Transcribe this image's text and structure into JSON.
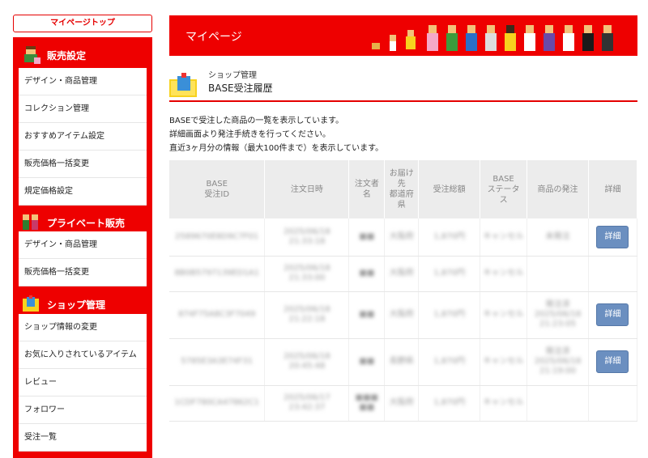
{
  "sidebar": {
    "top_button": "マイページトップ",
    "sections": [
      {
        "label": "販売設定",
        "icon": "seller-avatar-icon",
        "items": [
          "デザイン・商品管理",
          "コレクション管理",
          "おすすめアイテム設定",
          "販売価格一括変更",
          "規定価格設定"
        ]
      },
      {
        "label": "プライベート販売",
        "icon": "private-sale-icon",
        "items": [
          "デザイン・商品管理",
          "販売価格一括変更"
        ]
      },
      {
        "label": "ショップ管理",
        "icon": "shop-icon",
        "items": [
          "ショップ情報の変更",
          "お気に入りされているアイテム",
          "レビュー",
          "フォロワー",
          "受注一覧"
        ]
      }
    ]
  },
  "banner": {
    "title": "マイページ"
  },
  "page": {
    "subtitle": "ショップ管理",
    "title": "BASE受注履歴",
    "desc": [
      "BASEで受注した商品の一覧を表示しています。",
      "詳細画面より発注手続きを行ってください。",
      "直近3ヶ月分の情報（最大100件まで）を表示しています。"
    ]
  },
  "table": {
    "headers": [
      "BASE\n受注ID",
      "注文日時",
      "注文者\n名",
      "お届け\n先\n都道府\n県",
      "受注総額",
      "BASE\nステータ\nス",
      "商品の発注",
      "詳細"
    ],
    "detail_label": "詳細",
    "rows": [
      {
        "id": "2589670E8D9C7F01",
        "date": "2025/06/18\n21:33:18",
        "name": "■■",
        "pref": "大阪府",
        "total": "1,870円",
        "status": "キャンセル",
        "order": "未発注",
        "detail": true
      },
      {
        "id": "8B0B5797139ED1A1",
        "date": "2025/06/18\n21:33:00",
        "name": "■■",
        "pref": "大阪府",
        "total": "1,870円",
        "status": "キャンセル",
        "order": "",
        "detail": false
      },
      {
        "id": "874F75A8C3F7049",
        "date": "2025/06/18\n21:22:18",
        "name": "■■",
        "pref": "大阪府",
        "total": "1,870円",
        "status": "キャンセル",
        "order": "発注済\n2025/06/18\n21:23:05",
        "detail": true
      },
      {
        "id": "5785E3A3E74F31",
        "date": "2025/06/18\n20:45:48",
        "name": "■■",
        "pref": "長野県",
        "total": "1,870円",
        "status": "キャンセル",
        "order": "発注済\n2025/06/18\n21:19:00",
        "detail": true
      },
      {
        "id": "1CDF780CA47862C1",
        "date": "2025/06/17\n23:42:37",
        "name": "■■■\n■■",
        "pref": "大阪府",
        "total": "1,870円",
        "status": "キャンセル",
        "order": "",
        "detail": false
      }
    ]
  }
}
